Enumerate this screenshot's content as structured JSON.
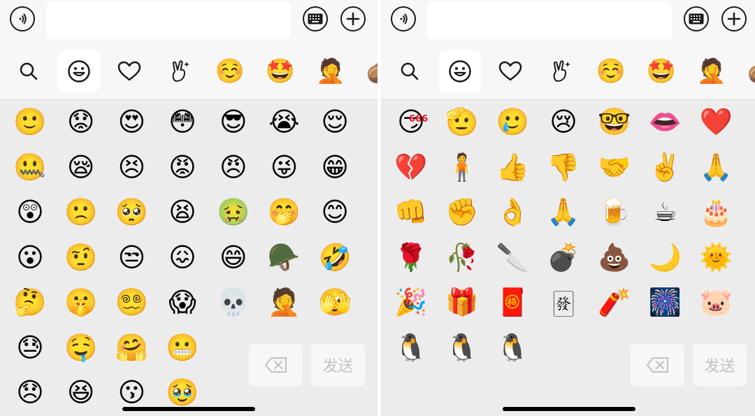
{
  "colors": {
    "panel_bg": "#ececec",
    "topbar_bg": "#f7f7f7",
    "icon_stroke": "#1a1a1a",
    "send_text": "#c3c3c3"
  },
  "left": {
    "input_value": "",
    "categories": [
      {
        "name": "search",
        "glyph": "search-icon"
      },
      {
        "name": "smileys",
        "glyph": "smiley-outline-icon",
        "active": true
      },
      {
        "name": "favorites",
        "glyph": "heart-outline-icon"
      },
      {
        "name": "gestures",
        "glyph": "peace-hand-icon"
      },
      {
        "name": "recent-1",
        "char": "☺️"
      },
      {
        "name": "recent-2",
        "char": "🤩"
      },
      {
        "name": "recent-3",
        "char": "🤦"
      },
      {
        "name": "recent-4",
        "char": "🥔"
      }
    ],
    "emoji_rows": [
      [
        "🙂",
        "😟",
        "😍",
        "😳",
        "😎",
        "😭",
        "😌"
      ],
      [
        "🤐",
        "😪",
        "😣",
        "😡",
        "😠",
        "😜",
        "😁"
      ],
      [
        "😲",
        "🙁",
        "🥺",
        "😫",
        "🤢",
        "🤭",
        "😊"
      ],
      [
        "😮",
        "🤨",
        "😒",
        "😖",
        "😄",
        "🪖",
        "🤣"
      ],
      [
        "🤔",
        "🤫",
        "😵‍💫",
        "😱",
        "💀",
        "🤦",
        "🫣"
      ],
      [
        "😓",
        "🤤",
        "🤗",
        "😬"
      ],
      [
        "😞",
        "😆",
        "😗",
        "🥹"
      ]
    ],
    "delete_label": "",
    "send_label": "发送"
  },
  "right": {
    "input_value": "",
    "categories": [
      {
        "name": "search",
        "glyph": "search-icon"
      },
      {
        "name": "smileys",
        "glyph": "smiley-outline-icon",
        "active": true
      },
      {
        "name": "favorites",
        "glyph": "heart-outline-icon"
      },
      {
        "name": "gestures",
        "glyph": "peace-hand-icon"
      },
      {
        "name": "recent-1",
        "char": "☺️"
      },
      {
        "name": "recent-2",
        "char": "🤩"
      },
      {
        "name": "recent-3",
        "char": "🤦"
      },
      {
        "name": "recent-4",
        "char": "🥔"
      }
    ],
    "emoji_rows": [
      [
        "😏",
        "🫡",
        "🥲",
        "😢",
        "🤓",
        "👄",
        "❤️"
      ],
      [
        "💔",
        "🧍",
        "👍",
        "👎",
        "🤝",
        "✌️",
        "🙏"
      ],
      [
        "👊",
        "✊",
        "👌",
        "🙏",
        "🍺",
        "☕",
        "🎂"
      ],
      [
        "🌹",
        "🥀",
        "🔪",
        "💣",
        "💩",
        "🌙",
        "🌞"
      ],
      [
        "🎉",
        "🎁",
        "🧧",
        "🀅",
        "🧨",
        "🎆",
        "🐷"
      ],
      [
        "🐧",
        "🐧",
        "🐧"
      ]
    ],
    "emoji_labels": {
      "r1c1_badge": "666"
    },
    "send_label": "发送"
  }
}
